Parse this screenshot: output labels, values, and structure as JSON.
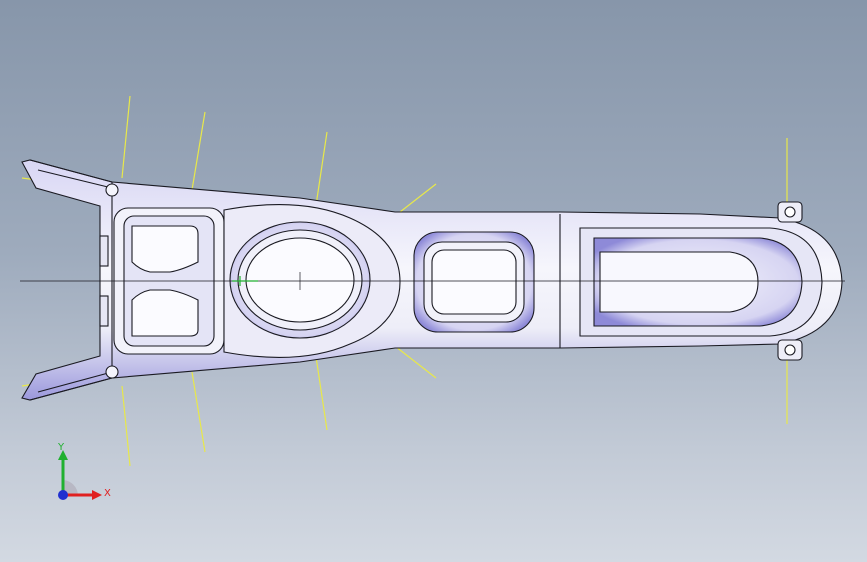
{
  "viewport": {
    "background_top": "#8796aa",
    "background_bottom": "#d3d9e2"
  },
  "model": {
    "outline_color": "#1a1a22",
    "fill_color": "#eeeef8",
    "shade_color": "#8a86d8",
    "construction_line_color": "#e8e84a"
  },
  "triad": {
    "x_label": "X",
    "y_label": "Y",
    "x_color": "#e02020",
    "y_color": "#20b030",
    "z_color": "#2030d0"
  }
}
